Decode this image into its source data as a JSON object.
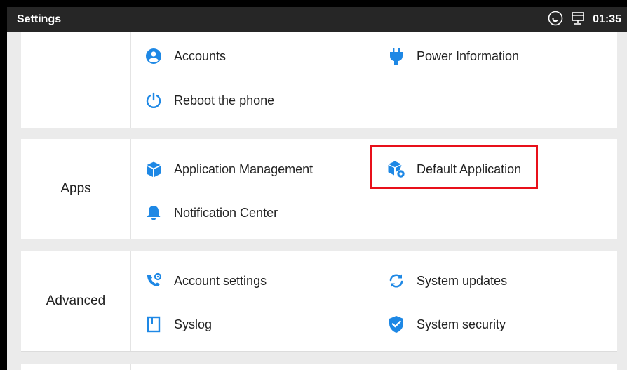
{
  "statusbar": {
    "title": "Settings",
    "time": "01:35"
  },
  "colors": {
    "accent": "#1e88e5",
    "highlight": "#e8101a"
  },
  "card1": {
    "items": [
      {
        "label": "Accounts",
        "icon": "account-circle-icon"
      },
      {
        "label": "Power Information",
        "icon": "power-plug-icon"
      },
      {
        "label": "Reboot the phone",
        "icon": "power-icon"
      }
    ]
  },
  "card2": {
    "section": "Apps",
    "items": [
      {
        "label": "Application Management",
        "icon": "box-icon"
      },
      {
        "label": "Default Application",
        "icon": "box-gear-icon"
      },
      {
        "label": "Notification Center",
        "icon": "bell-icon"
      }
    ]
  },
  "card3": {
    "section": "Advanced",
    "items": [
      {
        "label": "Account settings",
        "icon": "phone-gear-icon"
      },
      {
        "label": "System updates",
        "icon": "sync-icon"
      },
      {
        "label": "Syslog",
        "icon": "book-icon"
      },
      {
        "label": "System security",
        "icon": "shield-check-icon"
      }
    ]
  }
}
